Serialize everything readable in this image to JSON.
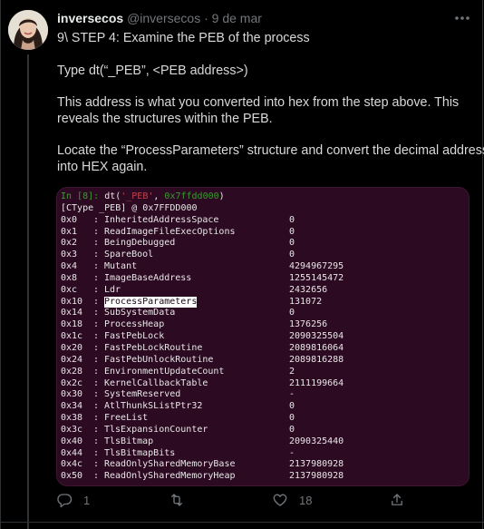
{
  "tweet": {
    "display_name": "inversecos",
    "handle": "@inversecos",
    "separator": "·",
    "date": "9 de mar",
    "lines": [
      "9\\ STEP 4: Examine the PEB of the process",
      "Type dt(“_PEB”, <PEB address>)",
      "This address is what you converted into hex from the step above. This",
      "reveals the structures within the PEB.",
      "Locate the “ProcessParameters” structure and convert the decimal address",
      "into HEX again."
    ]
  },
  "terminal": {
    "prompt": "In [8]:",
    "command_fn": "dt(",
    "command_str": "'_PEB'",
    "command_sep": ", ",
    "command_addr": "0x7ffdd000",
    "command_end": ")",
    "type_line": "[CType _PEB] @ 0x7FFDD000",
    "highlight_field": "ProcessParameters",
    "rows": [
      {
        "off": "0x0",
        "name": "InheritedAddressSpace",
        "val": "0"
      },
      {
        "off": "0x1",
        "name": "ReadImageFileExecOptions",
        "val": "0"
      },
      {
        "off": "0x2",
        "name": "BeingDebugged",
        "val": "0"
      },
      {
        "off": "0x3",
        "name": "SpareBool",
        "val": "0"
      },
      {
        "off": "0x4",
        "name": "Mutant",
        "val": "4294967295"
      },
      {
        "off": "0x8",
        "name": "ImageBaseAddress",
        "val": "1255145472"
      },
      {
        "off": "0xc",
        "name": "Ldr",
        "val": "2432656"
      },
      {
        "off": "0x10",
        "name": "ProcessParameters",
        "val": "131072"
      },
      {
        "off": "0x14",
        "name": "SubSystemData",
        "val": "0"
      },
      {
        "off": "0x18",
        "name": "ProcessHeap",
        "val": "1376256"
      },
      {
        "off": "0x1c",
        "name": "FastPebLock",
        "val": "2090325504"
      },
      {
        "off": "0x20",
        "name": "FastPebLockRoutine",
        "val": "2089816064"
      },
      {
        "off": "0x24",
        "name": "FastPebUnlockRoutine",
        "val": "2089816288"
      },
      {
        "off": "0x28",
        "name": "EnvironmentUpdateCount",
        "val": "2"
      },
      {
        "off": "0x2c",
        "name": "KernelCallbackTable",
        "val": "2111199664"
      },
      {
        "off": "0x30",
        "name": "SystemReserved",
        "val": "-"
      },
      {
        "off": "0x34",
        "name": "AtlThunkSListPtr32",
        "val": "0"
      },
      {
        "off": "0x38",
        "name": "FreeList",
        "val": "0"
      },
      {
        "off": "0x3c",
        "name": "TlsExpansionCounter",
        "val": "0"
      },
      {
        "off": "0x40",
        "name": "TlsBitmap",
        "val": "2090325440"
      },
      {
        "off": "0x44",
        "name": "TlsBitmapBits",
        "val": "-"
      },
      {
        "off": "0x4c",
        "name": "ReadOnlySharedMemoryBase",
        "val": "2137980928"
      },
      {
        "off": "0x50",
        "name": "ReadOnlySharedMemoryHeap",
        "val": "2137980928"
      }
    ]
  },
  "actions": {
    "reply": {
      "icon": "reply-icon",
      "count": "1"
    },
    "retweet": {
      "icon": "retweet-icon",
      "count": ""
    },
    "like": {
      "icon": "heart-icon",
      "count": "18"
    },
    "share": {
      "icon": "share-icon",
      "count": ""
    }
  },
  "colors": {
    "background": "#000000",
    "terminal_bg": "#2c0a22",
    "prompt_green": "#3c9a33",
    "string_red": "#c4424d",
    "muted": "#71767b"
  }
}
